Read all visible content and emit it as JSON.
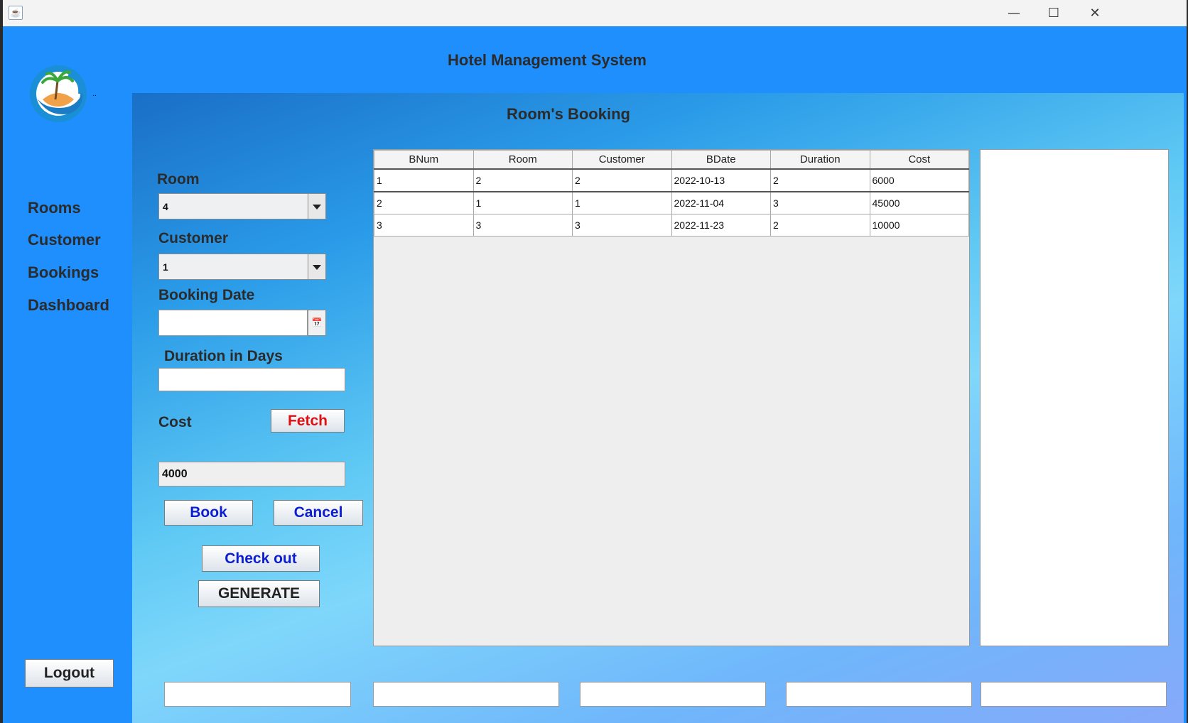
{
  "window": {
    "icon": "java-icon",
    "controls": {
      "minimize": "—",
      "maximize": "☐",
      "close": "✕"
    }
  },
  "header": {
    "title": "Hotel Management System"
  },
  "logo": {
    "icon": "island-logo-icon",
    "suffix": ".."
  },
  "sidebar": {
    "items": [
      {
        "label": "Rooms"
      },
      {
        "label": "Customer"
      },
      {
        "label": "Bookings"
      },
      {
        "label": "Dashboard"
      }
    ],
    "logout_label": "Logout"
  },
  "page": {
    "title": "Room's Booking"
  },
  "form": {
    "room_label": "Room",
    "room_value": "4",
    "customer_label": "Customer",
    "customer_value": "1",
    "booking_date_label": "Booking Date",
    "booking_date_value": "",
    "duration_label": "Duration in Days",
    "duration_value": "",
    "cost_label": "Cost",
    "cost_value": "4000",
    "fetch_label": "Fetch",
    "book_label": "Book",
    "cancel_label": "Cancel",
    "checkout_label": "Check out",
    "generate_label": "GENERATE"
  },
  "table": {
    "columns": [
      "BNum",
      "Room",
      "Customer",
      "BDate",
      "Duration",
      "Cost"
    ],
    "rows": [
      [
        "1",
        "2",
        "2",
        "2022-10-13",
        "2",
        "6000"
      ],
      [
        "2",
        "1",
        "1",
        "2022-11-04",
        "3",
        "45000"
      ],
      [
        "3",
        "3",
        "3",
        "2022-11-23",
        "2",
        "10000"
      ]
    ]
  },
  "colors": {
    "sidebar_bg": "#1e8ffc",
    "button_text_blue": "#0b1ed1",
    "button_text_red": "#e01010"
  }
}
